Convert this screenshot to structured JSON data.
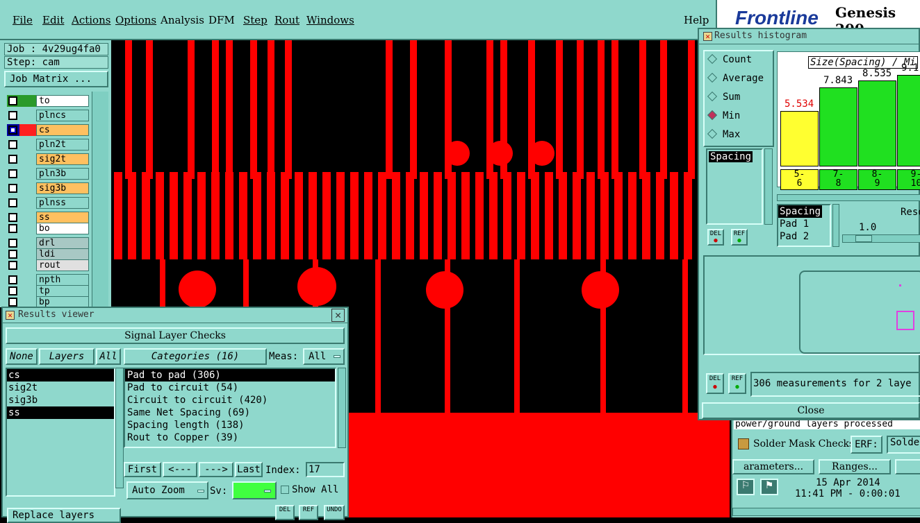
{
  "menu": {
    "items": [
      "File",
      "Edit",
      "Actions",
      "Options",
      "Analysis",
      "DFM",
      "Step",
      "Rout",
      "Windows"
    ],
    "help": "Help"
  },
  "brand": {
    "logo": "Frontline",
    "product": "Genesis 200"
  },
  "job": {
    "job_label": "Job : 4v29ug4fa0",
    "step_label": "Step: cam",
    "matrix_button": "Job Matrix ..."
  },
  "layers": [
    {
      "name": "to",
      "color": "#ffffff",
      "swatch": "#2a9a2a"
    },
    {
      "name": "plncs",
      "color": "#8fd8cc",
      "swatch": "#8fd8cc"
    },
    {
      "name": "cs",
      "color": "#ffc060",
      "swatch": "#ff2020"
    },
    {
      "name": "pln2t",
      "color": "#8fd8cc",
      "swatch": "#8fd8cc"
    },
    {
      "name": "sig2t",
      "color": "#ffc060",
      "swatch": "#8fd8cc"
    },
    {
      "name": "pln3b",
      "color": "#8fd8cc",
      "swatch": "#8fd8cc"
    },
    {
      "name": "sig3b",
      "color": "#ffc060",
      "swatch": "#8fd8cc"
    },
    {
      "name": "plnss",
      "color": "#8fd8cc",
      "swatch": "#8fd8cc"
    },
    {
      "name": "ss",
      "color": "#ffc060",
      "swatch": "#8fd8cc"
    },
    {
      "name": "bo",
      "color": "#ffffff",
      "swatch": "#8fd8cc"
    },
    {
      "name": "drl",
      "color": "#a8c8c4",
      "swatch": "#8fd8cc"
    },
    {
      "name": "ldi",
      "color": "#a8c8c4",
      "swatch": "#8fd8cc"
    },
    {
      "name": "rout",
      "color": "#e0e0e0",
      "swatch": "#8fd8cc"
    },
    {
      "name": "npth",
      "color": "#8fd8cc",
      "swatch": "#8fd8cc"
    },
    {
      "name": "tp",
      "color": "#8fd8cc",
      "swatch": "#8fd8cc"
    },
    {
      "name": "bp",
      "color": "#8fd8cc",
      "swatch": "#8fd8cc"
    }
  ],
  "viewer": {
    "title": "Results viewer",
    "header": "Signal Layer Checks",
    "none_btn": "None",
    "layers_btn": "Layers",
    "all_btn": "All",
    "layer_items": [
      "cs",
      "sig2t",
      "sig3b",
      "ss"
    ],
    "categories_btn": "Categories (16)",
    "meas_label": "Meas:",
    "meas_value": "All",
    "categories": [
      "Pad to pad (306)",
      "Pad to circuit (54)",
      "Circuit to circuit (420)",
      "Same Net Spacing (69)",
      "Spacing length (138)",
      "Rout to Copper (39)"
    ],
    "first": "First",
    "prev": "<---",
    "next": "--->",
    "last": "Last",
    "index_label": "Index:",
    "index_value": "17",
    "auto_zoom": "Auto Zoom",
    "sv_label": "Sv:",
    "show_all": "Show All",
    "replace_layers": "Replace layers",
    "del": "DEL",
    "ref": "REF",
    "undo": "UNDO"
  },
  "histogram": {
    "title": "Results histogram",
    "modes": [
      "Count",
      "Average",
      "Sum",
      "Min",
      "Max"
    ],
    "selected_mode": "Min",
    "field_selected": "Spacing",
    "chart_title": "Size(Spacing) / Mi",
    "bars": [
      {
        "label": "5.534",
        "range": "5-\n6",
        "color": "#ffff30",
        "value": 5.534
      },
      {
        "label": "7.843",
        "range": "7-\n8",
        "color": "#20e020",
        "value": 7.843
      },
      {
        "label": "8.535",
        "range": "8-\n9",
        "color": "#20e020",
        "value": 8.535
      },
      {
        "label": "9.1",
        "range": "9-\n10",
        "color": "#20e020",
        "value": 9.1
      }
    ],
    "fields": [
      "Spacing",
      "Pad 1",
      "Pad 2"
    ],
    "resolution_label": "Reso",
    "resolution_value": "1.0",
    "status": "306 measurements for 2 laye",
    "close": "Close",
    "del": "DEL",
    "ref": "REF"
  },
  "bottom_right": {
    "processed": "power/ground layers processed",
    "solder_mask": "Solder Mask Checks",
    "erf_label": "ERF:",
    "erf_value": "Solde",
    "parameters": "arameters...",
    "ranges": "Ranges...",
    "date": "15 Apr 2014",
    "time": "11:41 PM - 0:00:01"
  }
}
